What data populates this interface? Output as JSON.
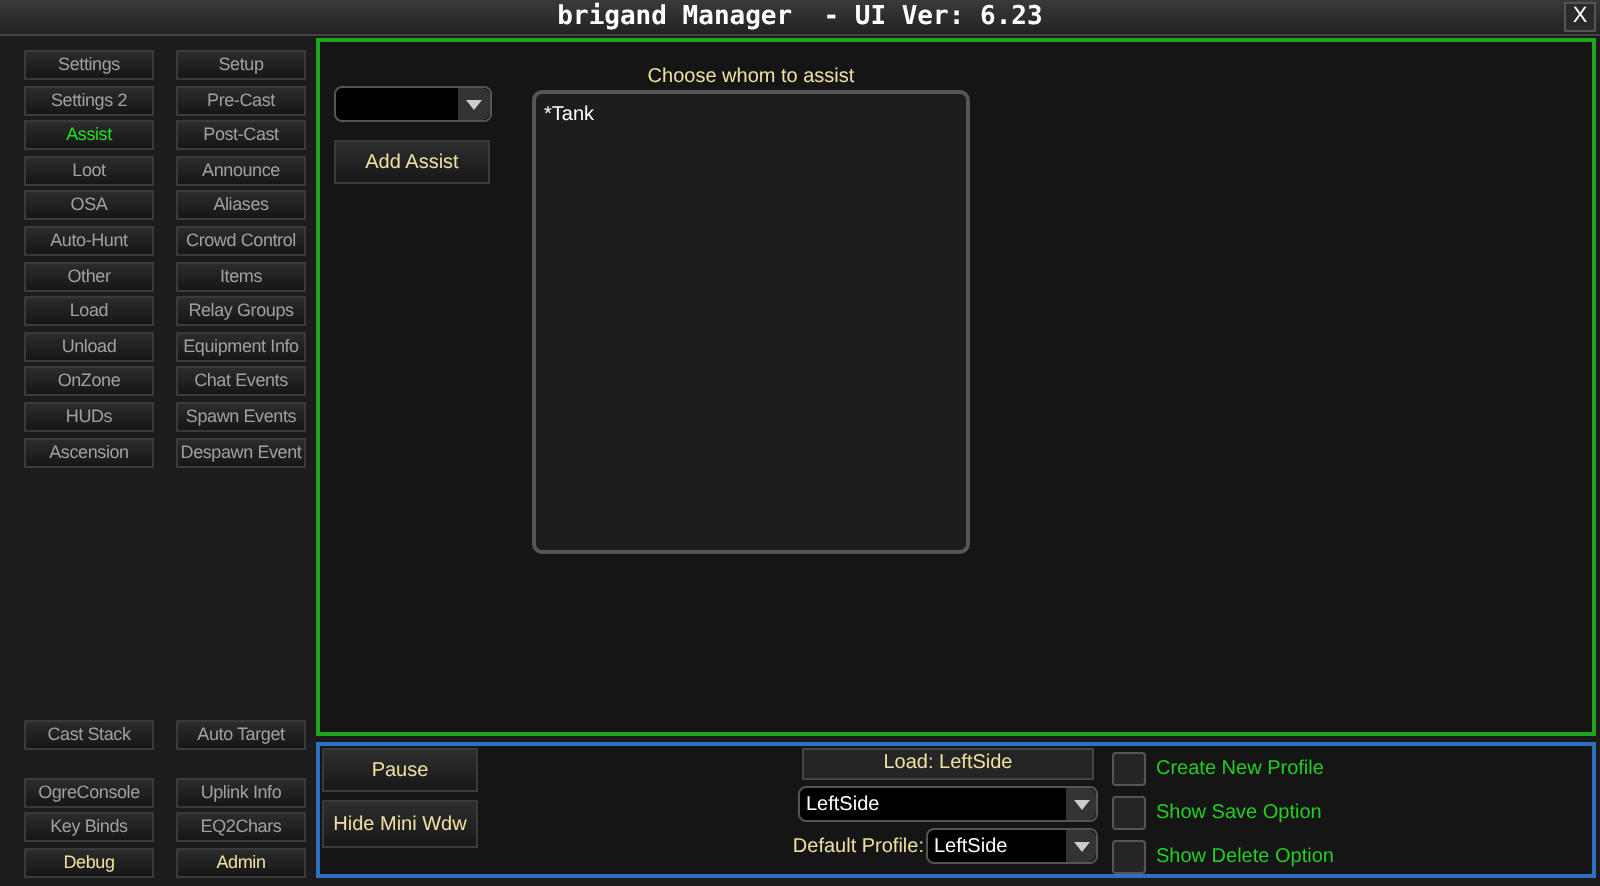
{
  "window": {
    "title": "brigand Manager  - UI Ver: 6.23",
    "close": "X"
  },
  "sidebar": {
    "tabs": [
      {
        "label": "Settings",
        "selected": false
      },
      {
        "label": "Setup",
        "selected": false
      },
      {
        "label": "Settings 2",
        "selected": false
      },
      {
        "label": "Pre-Cast",
        "selected": false
      },
      {
        "label": "Assist",
        "selected": true
      },
      {
        "label": "Post-Cast",
        "selected": false
      },
      {
        "label": "Loot",
        "selected": false
      },
      {
        "label": "Announce",
        "selected": false
      },
      {
        "label": "OSA",
        "selected": false
      },
      {
        "label": "Aliases",
        "selected": false
      },
      {
        "label": "Auto-Hunt",
        "selected": false
      },
      {
        "label": "Crowd Control",
        "selected": false
      },
      {
        "label": "Other",
        "selected": false
      },
      {
        "label": "Items",
        "selected": false
      },
      {
        "label": "Load",
        "selected": false
      },
      {
        "label": "Relay Groups",
        "selected": false
      },
      {
        "label": "Unload",
        "selected": false
      },
      {
        "label": "Equipment Info",
        "selected": false
      },
      {
        "label": "OnZone",
        "selected": false
      },
      {
        "label": "Chat Events",
        "selected": false
      },
      {
        "label": "HUDs",
        "selected": false
      },
      {
        "label": "Spawn Events",
        "selected": false
      },
      {
        "label": "Ascension",
        "selected": false
      },
      {
        "label": "Despawn Event",
        "selected": false
      }
    ],
    "middle": [
      {
        "label": "Cast Stack",
        "kind": "plain"
      },
      {
        "label": "Auto Target",
        "kind": "plain"
      }
    ],
    "bottom": [
      {
        "label": "OgreConsole",
        "kind": "plain"
      },
      {
        "label": "Uplink Info",
        "kind": "plain"
      },
      {
        "label": "Key Binds",
        "kind": "plain"
      },
      {
        "label": "EQ2Chars",
        "kind": "plain"
      },
      {
        "label": "Debug",
        "kind": "highlight"
      },
      {
        "label": "Admin",
        "kind": "highlight"
      }
    ]
  },
  "assist": {
    "add_button": "Add Assist",
    "list_caption": "Choose whom to assist",
    "list_items": [
      "*Tank"
    ]
  },
  "profile_bar": {
    "pause_button": "Pause",
    "hide_button": "Hide Mini Wdw",
    "load_button": "Load: LeftSide",
    "profile_value": "LeftSide",
    "default_label": "Default Profile:",
    "default_value": "LeftSide",
    "options": [
      {
        "label": "Create New Profile",
        "checked": false
      },
      {
        "label": "Show Save Option",
        "checked": false
      },
      {
        "label": "Show Delete Option",
        "checked": false
      }
    ]
  }
}
